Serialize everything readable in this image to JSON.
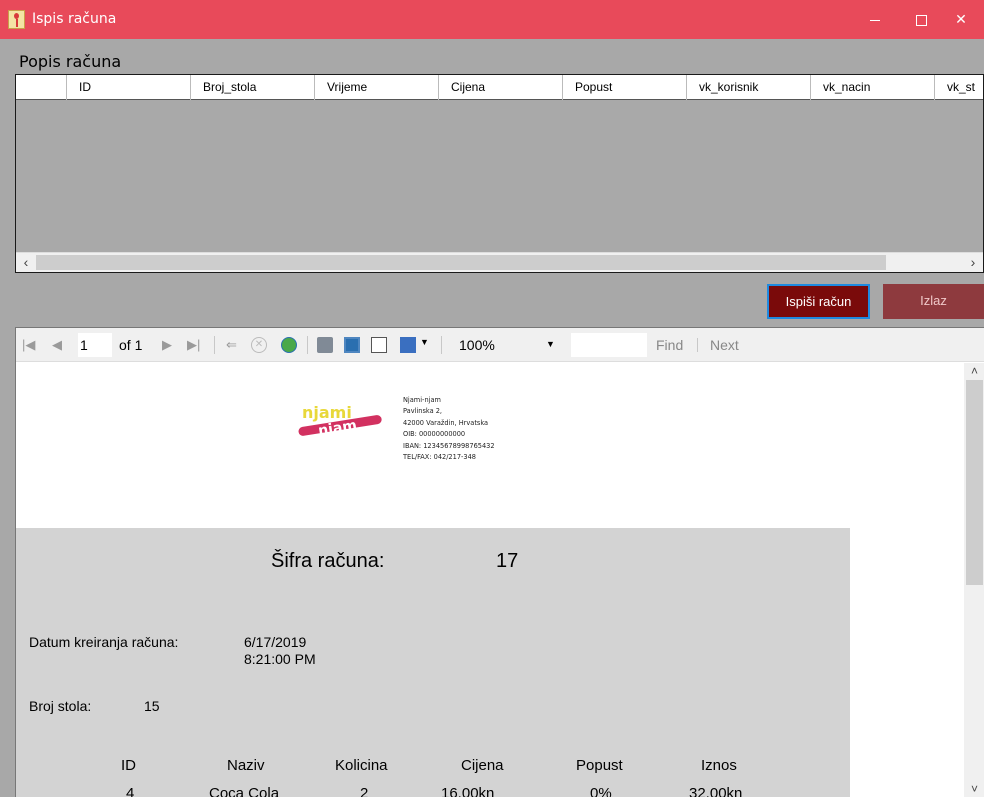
{
  "window": {
    "title": "Ispis računa"
  },
  "section": {
    "label": "Popis računa"
  },
  "grid": {
    "columns": [
      {
        "label": "ID"
      },
      {
        "label": "Broj_stola"
      },
      {
        "label": "Vrijeme"
      },
      {
        "label": "Cijena"
      },
      {
        "label": "Popust"
      },
      {
        "label": "vk_korisnik"
      },
      {
        "label": "vk_nacin"
      },
      {
        "label": "vk_st"
      }
    ]
  },
  "buttons": {
    "print": "Ispiši račun",
    "exit": "Izlaz"
  },
  "toolbar": {
    "page": "1",
    "of": "of 1",
    "zoom": "100%",
    "find": "Find",
    "next": "Next"
  },
  "company": {
    "name": "Njami-njam",
    "address": "Pavlinska 2,",
    "city": "42000 Varaždin, Hrvatska",
    "oib": "OIB: 00000000000",
    "iban": "IBAN: 12345678998765432",
    "tel": "TEL/FAX: 042/217-348",
    "logo_top": "njami",
    "logo_bottom": "njam"
  },
  "report": {
    "sifra_label": "Šifra računa:",
    "sifra_value": "17",
    "datum_label": "Datum kreiranja računa:",
    "datum_date": "6/17/2019",
    "datum_time": "8:21:00 PM",
    "stol_label": "Broj stola:",
    "stol_value": "15",
    "table_headers": [
      "ID",
      "Naziv",
      "Kolicina",
      "Cijena",
      "Popust",
      "Iznos"
    ],
    "rows": [
      [
        "4",
        "Coca Cola",
        "2",
        "16,00kn",
        "0%",
        "32,00kn"
      ]
    ]
  }
}
